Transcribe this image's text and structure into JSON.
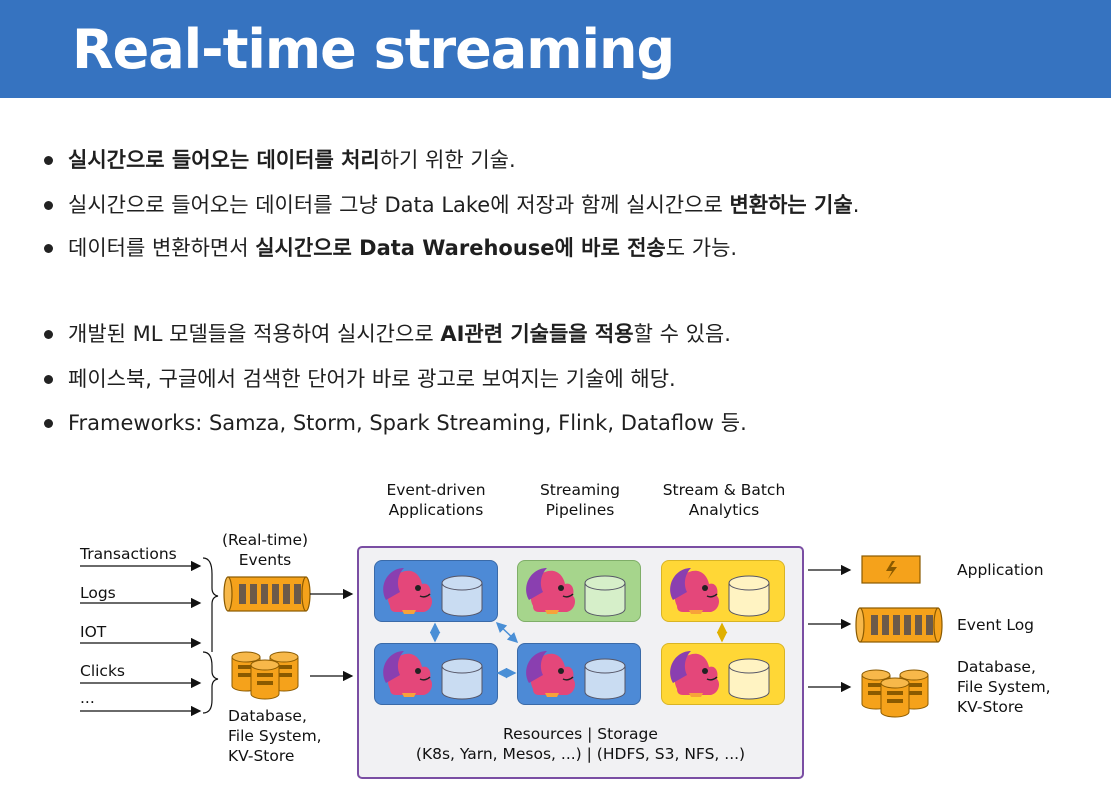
{
  "header": {
    "title": "Real-time streaming"
  },
  "bullets": [
    {
      "parts": [
        {
          "t": "실시간으로 들어오는 데이터를 처리",
          "b": true
        },
        {
          "t": "하기 위한 기술.",
          "b": false
        }
      ]
    },
    {
      "parts": [
        {
          "t": "실시간으로 들어오는 데이터를 그냥 Data Lake에 저장과 함께 실시간으로 ",
          "b": false
        },
        {
          "t": "변환하는 기술",
          "b": true
        },
        {
          "t": ".",
          "b": false
        }
      ]
    },
    {
      "parts": [
        {
          "t": "데이터를 변환하면서 ",
          "b": false
        },
        {
          "t": "실시간으로 Data Warehouse에 바로 전송",
          "b": true
        },
        {
          "t": "도 가능.",
          "b": false
        }
      ]
    },
    {
      "parts": [
        {
          "t": "개발된 ML 모델들을 적용하여 실시간으로 ",
          "b": false
        },
        {
          "t": "AI관련 기술들을 적용",
          "b": true
        },
        {
          "t": "할 수 있음.",
          "b": false
        }
      ]
    },
    {
      "parts": [
        {
          "t": "페이스북, 구글에서 검색한 단어가 바로 광고로 보여지는 기술에 해당.",
          "b": false
        }
      ]
    },
    {
      "parts": [
        {
          "t": "Frameworks: Samza, Storm, Spark Streaming, Flink, Dataflow 등.",
          "b": false
        }
      ]
    }
  ],
  "diagram": {
    "top_labels": [
      {
        "line1": "Event-driven",
        "line2": "Applications"
      },
      {
        "line1": "Streaming",
        "line2": "Pipelines"
      },
      {
        "line1": "Stream & Batch",
        "line2": "Analytics"
      }
    ],
    "sources": [
      "Transactions",
      "Logs",
      "IOT",
      "Clicks",
      "..."
    ],
    "events_label": {
      "line1": "(Real-time)",
      "line2": "Events"
    },
    "db_label_left": [
      "Database,",
      "File System,",
      "KV-Store"
    ],
    "resources": {
      "line1": "Resources | Storage",
      "line2": "(K8s, Yarn, Mesos, ...) | (HDFS, S3, NFS, ...)"
    },
    "outputs": [
      "Application",
      "Event Log"
    ],
    "db_label_right": [
      "Database,",
      "File System,",
      "KV-Store"
    ],
    "colors": {
      "blue": "#4d8ad6",
      "green": "#a6d58c",
      "yellow": "#ffd736",
      "orange": "#f5a21b",
      "purple": "#7a4ea3",
      "header": "#3673c0"
    }
  }
}
